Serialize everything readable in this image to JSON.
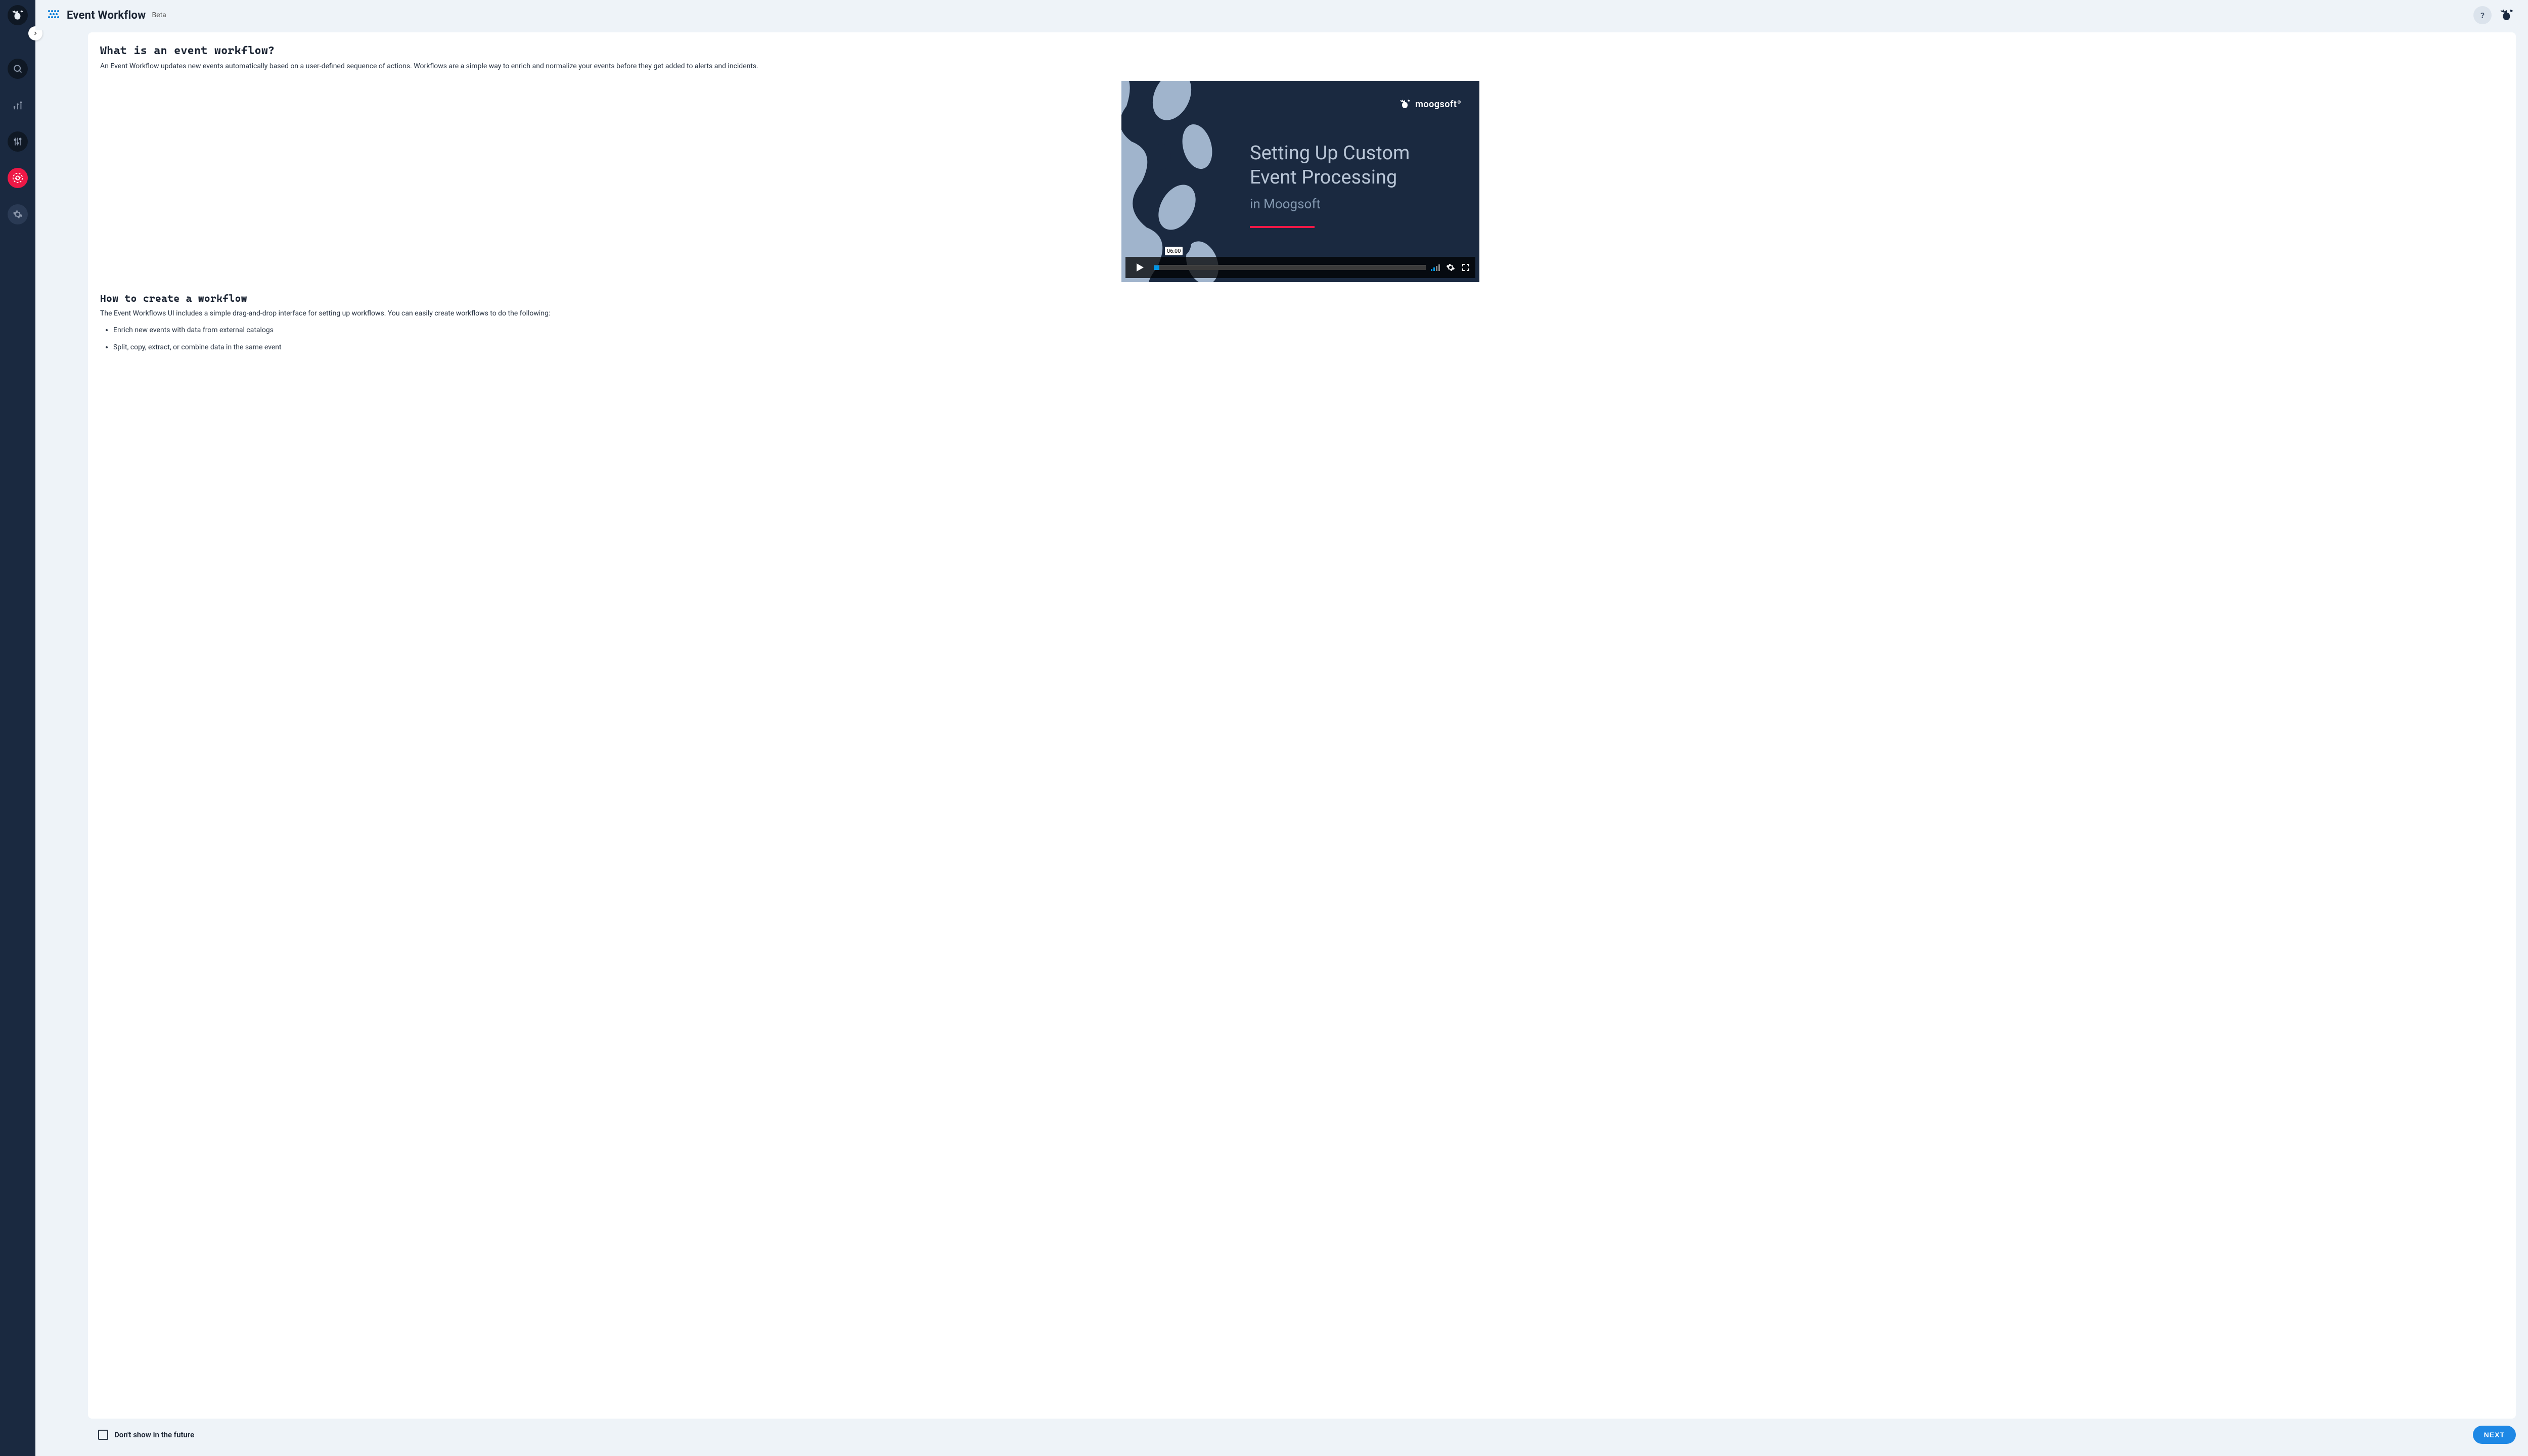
{
  "header": {
    "title": "Event Workflow",
    "badge": "Beta"
  },
  "sidebar": {
    "icons": [
      "logo",
      "search",
      "chart",
      "sliders",
      "sync",
      "cog"
    ]
  },
  "content": {
    "section1_title": "What is an event workflow?",
    "section1_body": "An Event Workflow updates new events automatically based on a user-defined sequence of actions. Workflows are a simple way to enrich and normalize your events before they get added to alerts and incidents.",
    "section2_title": "How to create a workflow",
    "section2_body": "The Event Workflows UI includes a simple drag-and-drop interface for setting up workflows. You can easily create workflows to do the following:",
    "bullets": [
      "Enrich new events with data from external catalogs",
      "Split, copy, extract, or combine data in the same event"
    ]
  },
  "video": {
    "brand": "moogsoft",
    "title_line1": "Setting Up Custom",
    "title_line2": "Event Processing",
    "subtitle": "in Moogsoft",
    "time": "06:00"
  },
  "footer": {
    "checkbox_label": "Don't show in the future",
    "next_label": "NEXT"
  }
}
